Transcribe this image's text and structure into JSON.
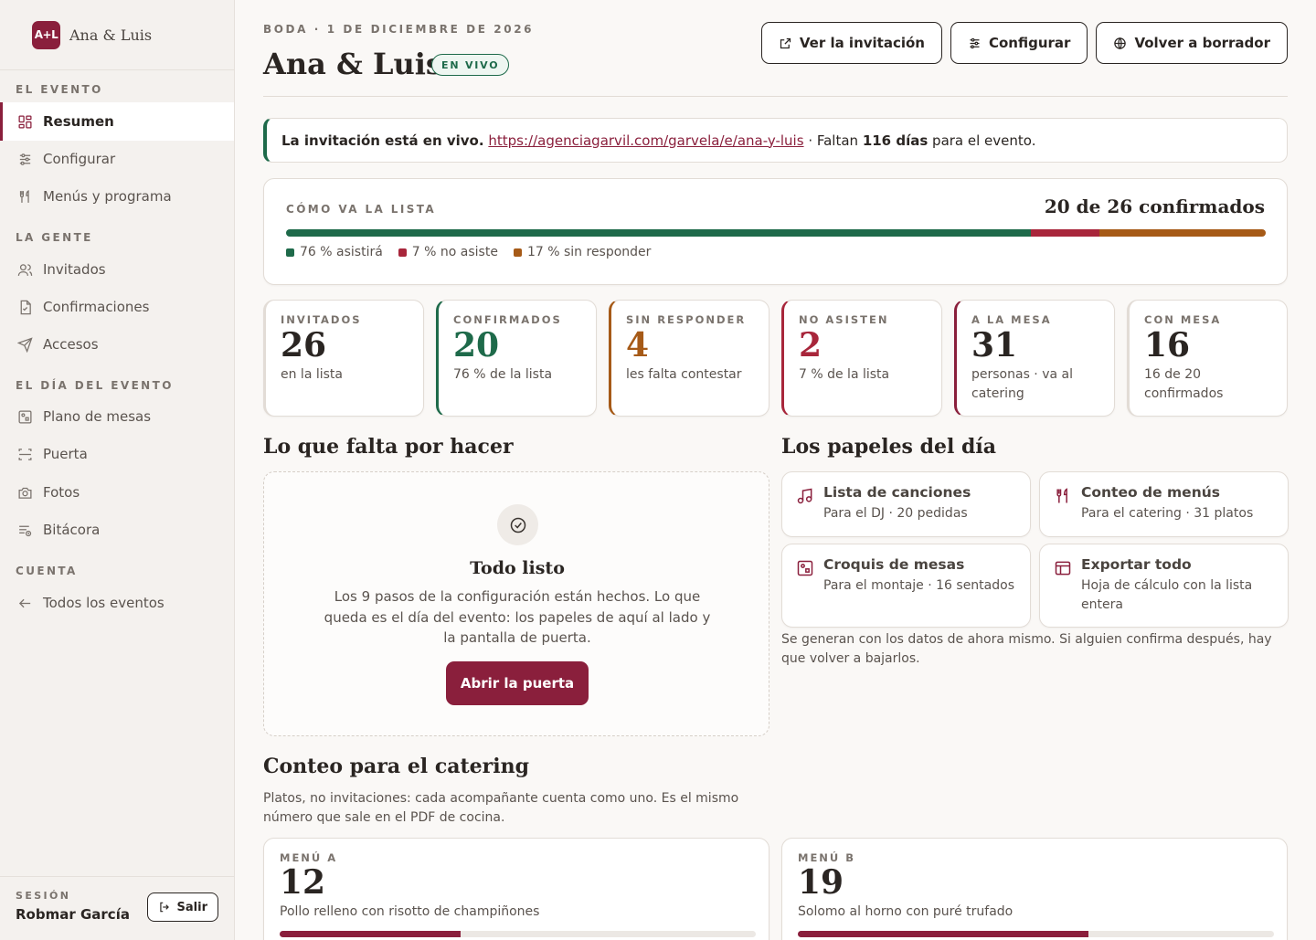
{
  "brand": {
    "logo": "A+L",
    "name": "Ana & Luis"
  },
  "sidebar": {
    "sections": [
      {
        "title": "EL EVENTO"
      },
      {
        "title": "LA GENTE"
      },
      {
        "title": "EL DÍA DEL EVENTO"
      },
      {
        "title": "CUENTA"
      }
    ],
    "items": [
      {
        "label": "Resumen",
        "icon": "grid-icon"
      },
      {
        "label": "Configurar",
        "icon": "sliders-icon"
      },
      {
        "label": "Menús y programa",
        "icon": "utensils-icon"
      },
      {
        "label": "Invitados",
        "icon": "users-icon"
      },
      {
        "label": "Confirmaciones",
        "icon": "file-check-icon"
      },
      {
        "label": "Accesos",
        "icon": "send-icon"
      },
      {
        "label": "Plano de mesas",
        "icon": "floorplan-icon"
      },
      {
        "label": "Puerta",
        "icon": "door-icon"
      },
      {
        "label": "Fotos",
        "icon": "camera-icon"
      },
      {
        "label": "Bitácora",
        "icon": "log-icon"
      },
      {
        "label": "Todos los eventos",
        "icon": "arrow-left-icon"
      }
    ],
    "session_label": "SESIÓN",
    "session_user": "Robmar García",
    "logout_label": "Salir"
  },
  "header": {
    "eyebrow": "BODA · 1 DE DICIEMBRE DE 2026",
    "title": "Ana & Luis",
    "badge": "EN VIVO",
    "actions": {
      "view": "Ver la invitación",
      "configure": "Configurar",
      "draft": "Volver a borrador"
    }
  },
  "banner": {
    "lead": "La invitación está en vivo.",
    "url": "https://agenciagarvil.com/garvela/e/ana-y-luis",
    "sep": " · Faltan ",
    "days": "116 días",
    "tail": " para el evento."
  },
  "progress": {
    "label": "CÓMO VA LA LISTA",
    "total": "20 de 26 confirmados",
    "segments": [
      {
        "label": "76 % asistirá",
        "percent": 76,
        "color": "#1e6a4a"
      },
      {
        "label": "7 % no asiste",
        "percent": 7,
        "color": "#a8263b"
      },
      {
        "label": "17 % sin responder",
        "percent": 17,
        "color": "#a65a17"
      }
    ]
  },
  "stats": [
    {
      "label": "INVITADOS",
      "value": "26",
      "sub": "en la lista",
      "accent": "#e2dcd6",
      "value_color": "#2a2522"
    },
    {
      "label": "CONFIRMADOS",
      "value": "20",
      "sub": "76 % de la lista",
      "accent": "#1e6a4a",
      "value_color": "#1e6a4a"
    },
    {
      "label": "SIN RESPONDER",
      "value": "4",
      "sub": "les falta contestar",
      "accent": "#a65a17",
      "value_color": "#a65a17"
    },
    {
      "label": "NO ASISTEN",
      "value": "2",
      "sub": "7 % de la lista",
      "accent": "#a8263b",
      "value_color": "#a8263b"
    },
    {
      "label": "A LA MESA",
      "value": "31",
      "sub": "personas · va al catering",
      "accent": "#8a1f3c",
      "value_color": "#2a2522"
    },
    {
      "label": "CON MESA",
      "value": "16",
      "sub": "16 de 20 confirmados",
      "accent": "#e2dcd6",
      "value_color": "#2a2522"
    }
  ],
  "todo": {
    "section_title": "Lo que falta por hacer",
    "title": "Todo listo",
    "text": "Los 9 pasos de la configuración están hechos. Lo que queda es el día del evento: los papeles de aquí al lado y la pantalla de puerta.",
    "button": "Abrir la puerta"
  },
  "papers": {
    "section_title": "Los papeles del día",
    "items": [
      {
        "title": "Lista de canciones",
        "sub": "Para el DJ · 20 pedidas",
        "icon": "music-icon"
      },
      {
        "title": "Conteo de menús",
        "sub": "Para el catering · 31 platos",
        "icon": "utensils-icon"
      },
      {
        "title": "Croquis de mesas",
        "sub": "Para el montaje · 16 sentados",
        "icon": "floorplan-icon"
      },
      {
        "title": "Exportar todo",
        "sub": "Hoja de cálculo con la lista entera",
        "icon": "table-icon"
      }
    ],
    "note": "Se generan con los datos de ahora mismo. Si alguien confirma después, hay que volver a bajarlos."
  },
  "catering": {
    "section_title": "Conteo para el catering",
    "note": "Platos, no invitaciones: cada acompañante cuenta como uno. Es el mismo número que sale en el PDF de cocina.",
    "menus": [
      {
        "label": "MENÚ A",
        "value": "12",
        "desc": "Pollo relleno con risotto de champiñones",
        "share": 0.38
      },
      {
        "label": "MENÚ B",
        "value": "19",
        "desc": "Solomo al horno con puré trufado",
        "share": 0.61
      }
    ]
  }
}
